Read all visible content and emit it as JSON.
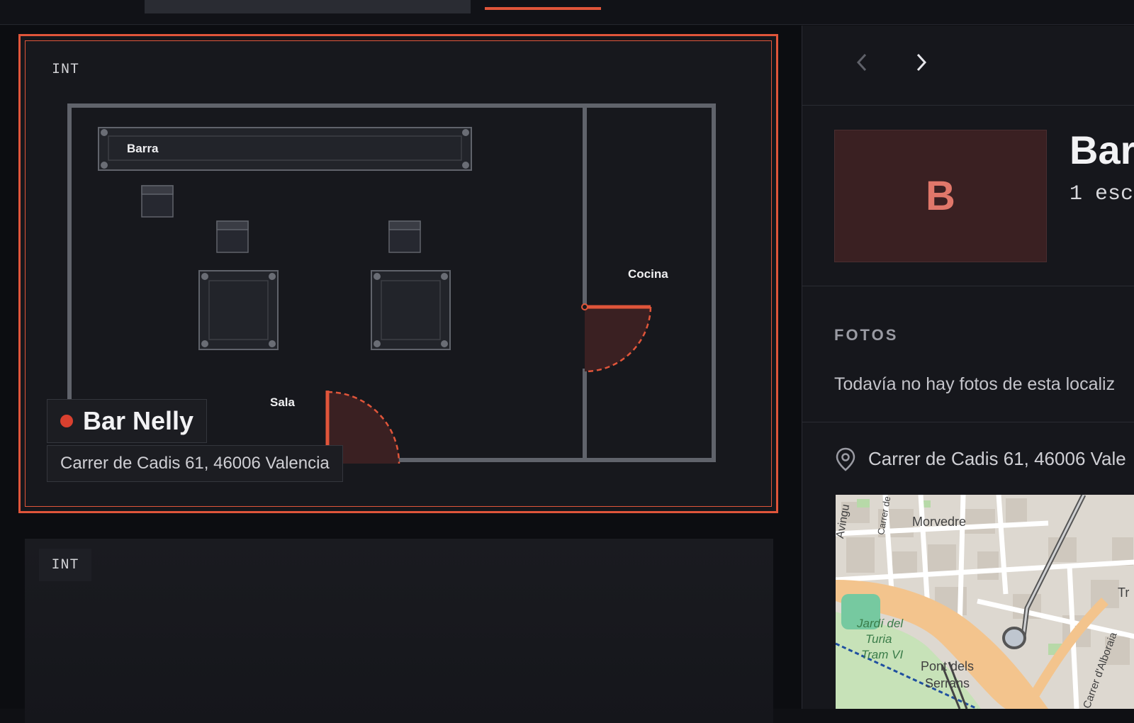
{
  "card1": {
    "int_label": "INT",
    "rooms": {
      "barra": "Barra",
      "cocina": "Cocina",
      "sala": "Sala"
    },
    "name": "Bar Nelly",
    "address": "Carrer de Cadis 61, 46006 Valencia",
    "accent": "#e0553a"
  },
  "card2": {
    "int_label": "INT"
  },
  "sidebar": {
    "prev_icon": "chevron-left-icon",
    "next_icon": "chevron-right-icon",
    "thumb_letter": "B",
    "title": "Bar",
    "scenes": "1 esc",
    "photos_label": "FOTOS",
    "photos_empty": "Todavía no hay fotos de esta localiz",
    "address": "Carrer de Cadis 61, 46006 Vale",
    "pin_icon": "map-pin-icon"
  },
  "map": {
    "labels": {
      "morvedre": "Morvedre",
      "visita": "Carrer de la Visita",
      "jardi1": "Jardí del",
      "jardi2": "Turia",
      "jardi3": "Tram VI",
      "pont1": "Pont dels",
      "pont2": "Serrans",
      "alboraia": "Carrer d'Alboraia",
      "avingu": "Avingu",
      "tr": "Tr"
    }
  }
}
